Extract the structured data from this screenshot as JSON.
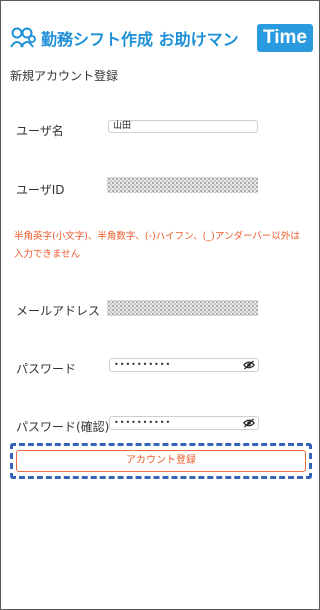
{
  "header": {
    "brand_title": "勤務シフト作成 お助けマン",
    "brand_badge": "Time"
  },
  "page": {
    "title": "新規アカウント登録"
  },
  "form": {
    "username": {
      "label": "ユーザ名",
      "value": "山田"
    },
    "user_id": {
      "label": "ユーザID"
    },
    "error_message": "半角英字(小文字)、半角数字、(-)ハイフン、(_)アンダーバー以外は入力できません",
    "email": {
      "label": "メールアドレス"
    },
    "password": {
      "label": "パスワード",
      "value": "••••••••••"
    },
    "password_confirm": {
      "label": "パスワード(確認)",
      "value": "••••••••••"
    },
    "submit_label": "アカウント登録"
  },
  "icons": {
    "logo": "people-logo-icon",
    "password_toggle": "eye-slash-icon"
  },
  "colors": {
    "brand_blue": "#1e90d8",
    "badge_blue": "#2b9be0",
    "error_orange": "#ee5a2a",
    "highlight_dash": "#3465b8"
  }
}
